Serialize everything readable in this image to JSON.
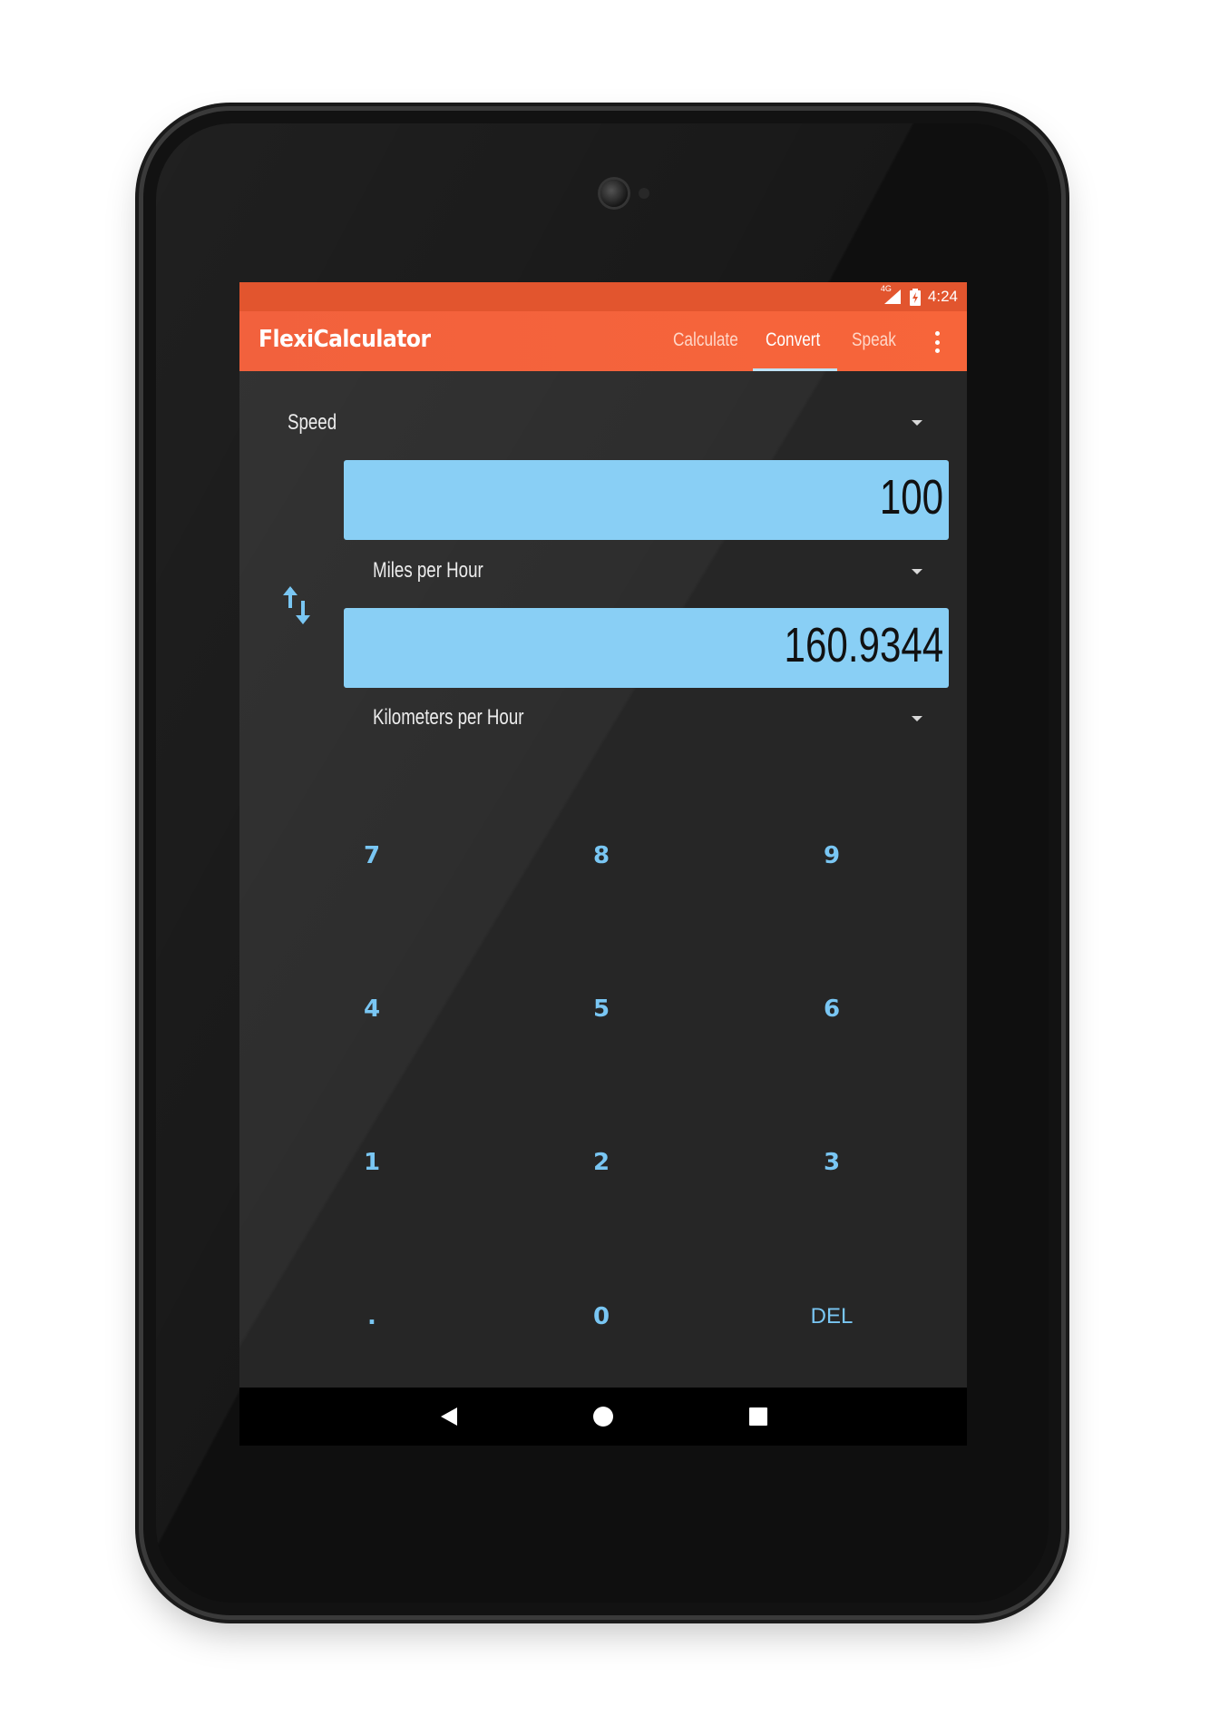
{
  "status_bar": {
    "network": "4G",
    "time": "4:24"
  },
  "app_bar": {
    "title": "FlexiCalculator",
    "tabs": [
      {
        "label": "Calculate",
        "active": false
      },
      {
        "label": "Convert",
        "active": true
      },
      {
        "label": "Speak",
        "active": false
      }
    ]
  },
  "converter": {
    "category": "Speed",
    "input_value": "100",
    "input_unit": "Miles per Hour",
    "output_value": "160.9344",
    "output_unit": "Kilometers per Hour"
  },
  "keypad": {
    "keys": [
      "7",
      "8",
      "9",
      "4",
      "5",
      "6",
      "1",
      "2",
      "3",
      ".",
      "0",
      "DEL"
    ]
  },
  "colors": {
    "accent": "#f7653a",
    "status_bar": "#e2552e",
    "value_box": "#89cff5",
    "key_text": "#79c6f3",
    "background": "#262626"
  },
  "icons": [
    "battery-icon",
    "signal-icon",
    "overflow-menu-icon",
    "swap-icon",
    "back-icon",
    "home-icon",
    "recents-icon"
  ]
}
